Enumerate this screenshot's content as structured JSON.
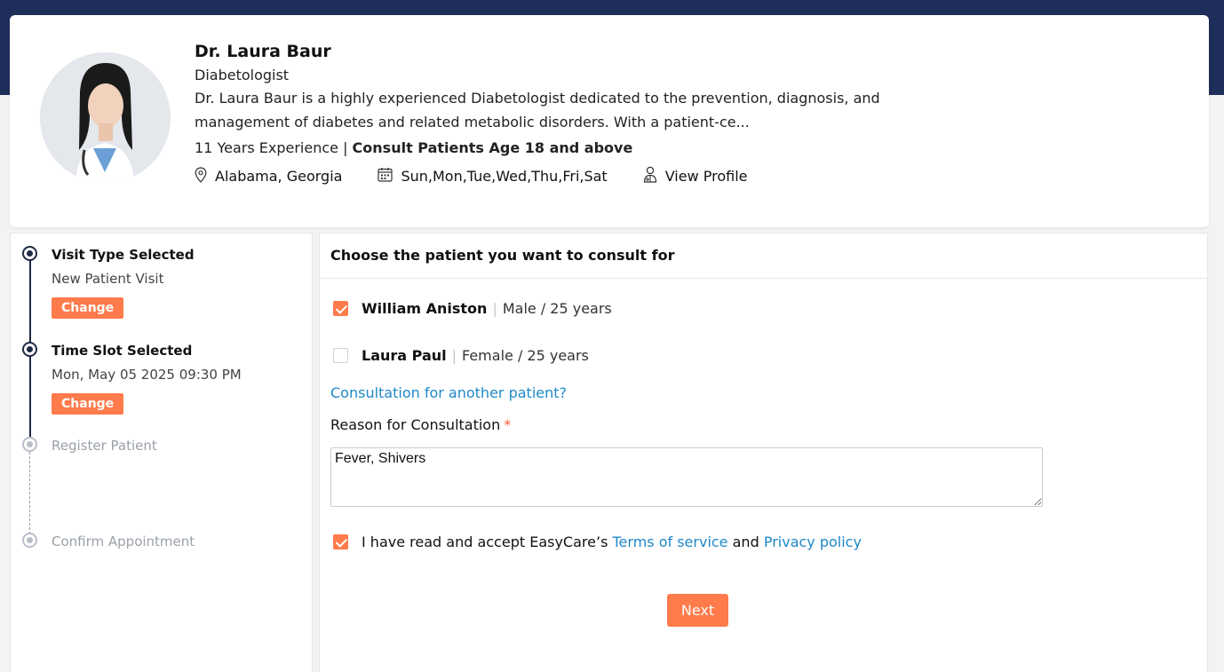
{
  "doctor": {
    "name": "Dr. Laura Baur",
    "specialty": "Diabetologist",
    "bio": "Dr. Laura Baur is a highly experienced Diabetologist dedicated to the prevention, diagnosis, and management of diabetes and related metabolic disorders. With a patient-ce...",
    "experience": "11 Years Experience",
    "separator": "|",
    "age_policy": "Consult Patients Age 18 and above",
    "location": "Alabama, Georgia",
    "days": "Sun,Mon,Tue,Wed,Thu,Fri,Sat",
    "view_profile": "View Profile",
    "icons": {
      "location": "map-pin-icon",
      "days": "calendar-icon",
      "profile": "doctor-icon"
    }
  },
  "steps": [
    {
      "title": "Visit Type Selected",
      "subtitle": "New Patient Visit",
      "action": "Change",
      "state": "done"
    },
    {
      "title": "Time Slot Selected",
      "subtitle": "Mon, May 05 2025 09:30 PM",
      "action": "Change",
      "state": "done"
    },
    {
      "title": "Register Patient",
      "state": "pending"
    },
    {
      "title": "Confirm Appointment",
      "state": "pending"
    }
  ],
  "main": {
    "heading": "Choose the patient you want to consult for",
    "patients": [
      {
        "name": "William Aniston",
        "sep": "|",
        "detail": "Male / 25 years",
        "checked": true
      },
      {
        "name": "Laura Paul",
        "sep": "|",
        "detail": "Female / 25 years",
        "checked": false
      }
    ],
    "another_patient_link": "Consultation for another patient?",
    "reason_label": "Reason for Consultation",
    "required_mark": "*",
    "reason_value": "Fever, Shivers",
    "terms_prefix": "I have read and accept EasyCare’s",
    "terms_link": "Terms of service",
    "terms_and": "and",
    "privacy_link": "Privacy policy",
    "terms_checked": true,
    "next_label": "Next"
  },
  "colors": {
    "header_navy": "#1f2d5a",
    "accent_orange": "#ff7b4b",
    "link_blue": "#1e88c7",
    "step_active": "#1f2a44",
    "step_inactive": "#b9bec8"
  }
}
